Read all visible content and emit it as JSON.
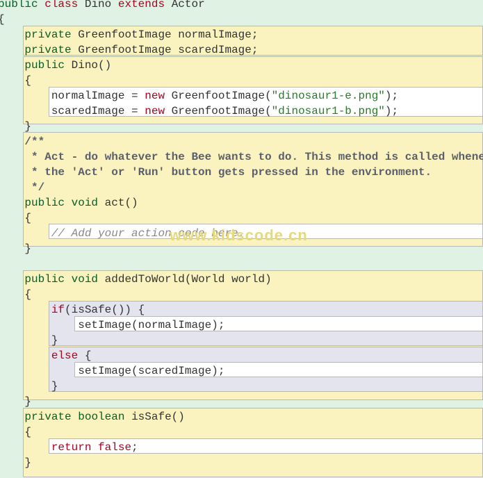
{
  "line": {
    "l0": "public class Dino extends Actor",
    "k_public": "public",
    "k_class": "class",
    "dino": "Dino",
    "k_extends": "extends",
    "actor": "Actor",
    "obrace": "{",
    "cbrace": "}",
    "k_private": "private",
    "gi": "GreenfootImage",
    "normalImage_decl": "normalImage;",
    "scaredImage_decl": "scaredImage;",
    "dino_ctor": "Dino()",
    "assign_normal_a": "normalImage = ",
    "assign_scared_a": "scaredImage = ",
    "k_new": "new",
    "gi_open": " GreenfootImage(",
    "str_e": "\"dinosaur1-e.png\"",
    "str_b": "\"dinosaur1-b.png\"",
    "close_paren_semi": ");",
    "doc1": "/**",
    "doc2": " * Act - do whatever the Bee wants to do. This method is called whene",
    "doc3": " * the 'Act' or 'Run' button gets pressed in the environment.",
    "doc4": " */",
    "k_void": "void",
    "act_sig": "act()",
    "add_action": "// Add your action code here.",
    "added_sig": "addedToWorld(World world)",
    "k_if": "if",
    "issafe_call": "(isSafe()) {",
    "setimg_normal": "setImage(normalImage);",
    "k_else": "else",
    "else_brace": " {",
    "setimg_scared": "setImage(scaredImage);",
    "k_boolean": "boolean",
    "issafe_sig": "isSafe()",
    "k_return": "return",
    "k_false": "false",
    "semi": ";"
  },
  "watermark": "www.kidscode.cn"
}
